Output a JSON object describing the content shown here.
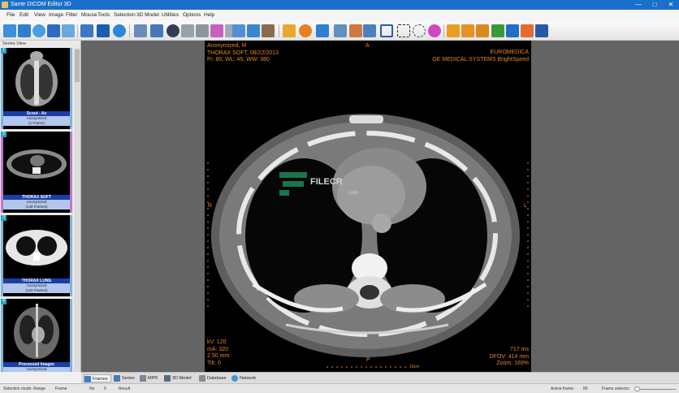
{
  "titlebar": {
    "title": "Sante DICOM Editor 3D",
    "minimize": "—",
    "maximize": "□",
    "close": "✕"
  },
  "menu": [
    "File",
    "Edit",
    "View",
    "Image",
    "Filter",
    "Mouse",
    "Tools",
    "Selection",
    "3D Model",
    "Utilities",
    "Options",
    "Help"
  ],
  "toolbar": {
    "icons": [
      "open-folder-icon",
      "open-cd-icon",
      "cloud-icon",
      "save-icon",
      "print-icon",
      "export-icon",
      "monitor-icon",
      "info-icon",
      "tools-icon",
      "settings-icon",
      "eye-icon",
      "anonymize-icon",
      "compare-icon",
      "pattern-icon",
      "grid-icon",
      "layout-icon",
      "zoom-fit-icon",
      "portrait-icon",
      "shield-icon",
      "brightness-icon",
      "pan-arrows-icon",
      "magnify-icon",
      "image-icon",
      "zoom-icon",
      "rectangle-select-icon",
      "dotted-select-icon",
      "freehand-select-icon",
      "color-icon",
      "angle-icon",
      "protractor-icon",
      "corner-icon",
      "line-icon",
      "arrow-icon",
      "eraser-icon",
      "text-icon"
    ]
  },
  "series_panel": {
    "header": "Series View",
    "items": [
      {
        "number": "1",
        "title": "Scout - Ax",
        "status": "Anonymized",
        "frames": "(1 Frame)"
      },
      {
        "number": "2",
        "title": "THORAX SOFT",
        "status": "Anonymized",
        "frames": "(140 Frames)"
      },
      {
        "number": "3",
        "title": "THORAX LUNG",
        "status": "Anonymized",
        "frames": "(122 Frames)"
      },
      {
        "number": "4",
        "title": "Processed Images",
        "status": "Anonymized",
        "frames": "(56 Frames)"
      }
    ]
  },
  "viewer": {
    "top_left": [
      "Anonymized, M",
      "THORAX SOFT, 08/22/2013",
      "Fr: 80, WL: 45, WW: 380"
    ],
    "top_right": [
      "EUROMEDICA",
      "GE MEDICAL SYSTEMS BrightSpeed"
    ],
    "bottom_left": [
      "kV: 120",
      "mA: 320",
      "2.50 mm",
      "Tilt: 0"
    ],
    "bottom_right": [
      "717 ms",
      "DFOV: 414 mm",
      "Zoom: 169%"
    ],
    "orientation": {
      "top": "A",
      "bottom": "P",
      "left": "R",
      "right": "L"
    },
    "scale_label": "10cm",
    "watermark": {
      "brand": "FILECR",
      "sub": ".com"
    }
  },
  "tabs": [
    "Frames",
    "Series",
    "MPR",
    "3D Model",
    "Database",
    "Network"
  ],
  "statusbar": {
    "mode_label": "Selection mode: Range",
    "mode_value": "Frame",
    "count_label": "No",
    "count_value": "0",
    "result_label": "Result",
    "active_frame_label": "Active frame:",
    "active_frame_value": "80",
    "frame_selector_label": "Frame selector:"
  },
  "colors": {
    "accent": "#1c6fc8",
    "overlay_text": "#e8852a",
    "series_caption": "#1a3ea8"
  }
}
